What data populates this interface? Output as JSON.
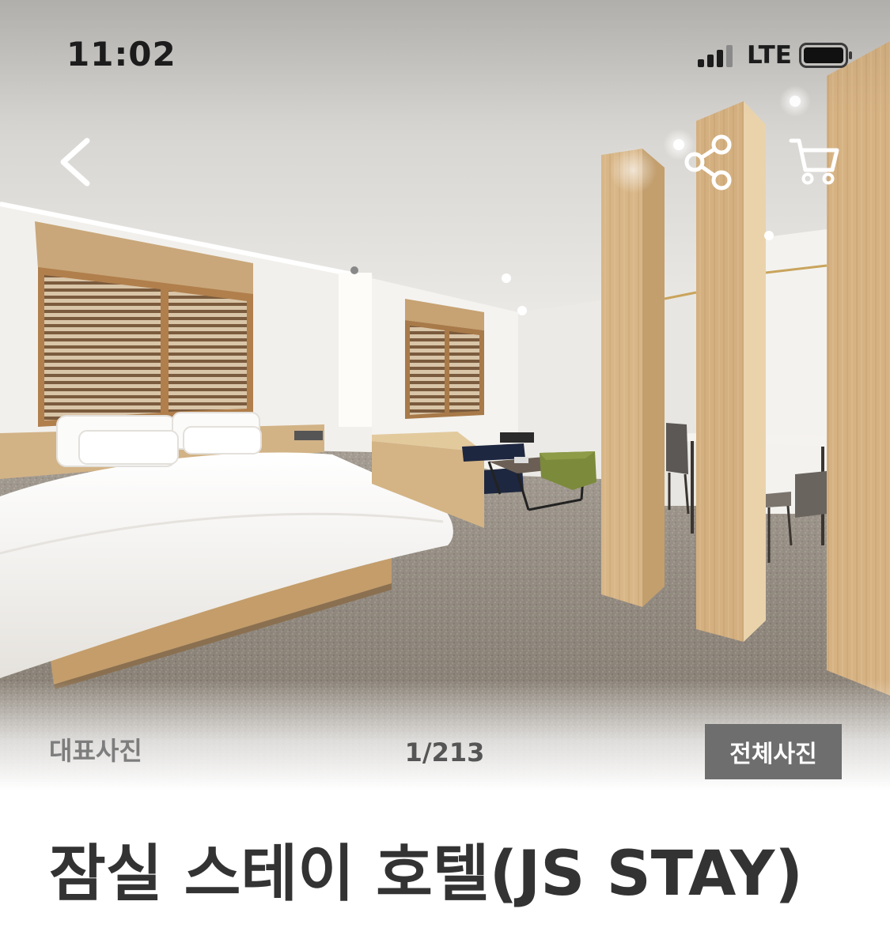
{
  "status_bar": {
    "time": "11:02",
    "network": "LTE",
    "signal_icon": "signal-bars-icon",
    "battery_icon": "battery-icon"
  },
  "top_nav": {
    "back_icon": "chevron-left-icon",
    "share_icon": "share-icon",
    "cart_icon": "cart-icon"
  },
  "gallery": {
    "label": "대표사진",
    "counter": "1/213",
    "view_all_label": "전체사진"
  },
  "hotel": {
    "name": "잠실 스테이 호텔(JS STAY)"
  },
  "colors": {
    "view_all_button": "#6e6e6e",
    "title_text": "#333333",
    "overlay_icons": "#ffffff"
  }
}
